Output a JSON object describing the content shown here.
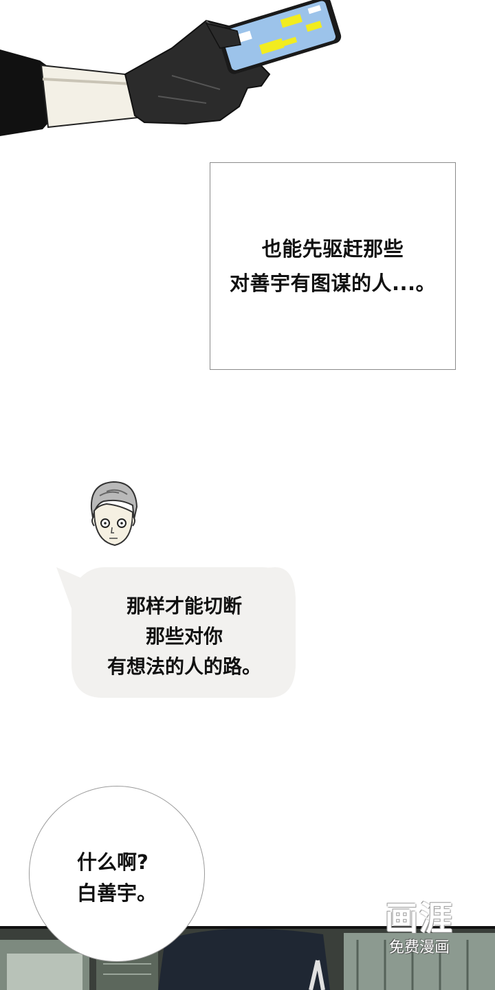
{
  "narration": {
    "text": "也能先驱赶那些\n对善宇有图谋的人...。"
  },
  "speech_bubble": {
    "text": "那样才能切断\n那些对你\n有想法的人的路。"
  },
  "round_bubble": {
    "text": "什么啊?\n白善宇。"
  },
  "watermark": {
    "logo": "画涯",
    "subtitle": "免费漫画"
  },
  "colors": {
    "background": "#ffffff",
    "bubble_fill": "#f2f1ef",
    "phone_screen": "#9cc3ea",
    "phone_highlight": "#f2ec1f",
    "glove": "#2b2b2b"
  },
  "icons": [
    "gloved-hand-phone-illustration",
    "character-face-illustration",
    "city-street-illustration"
  ]
}
